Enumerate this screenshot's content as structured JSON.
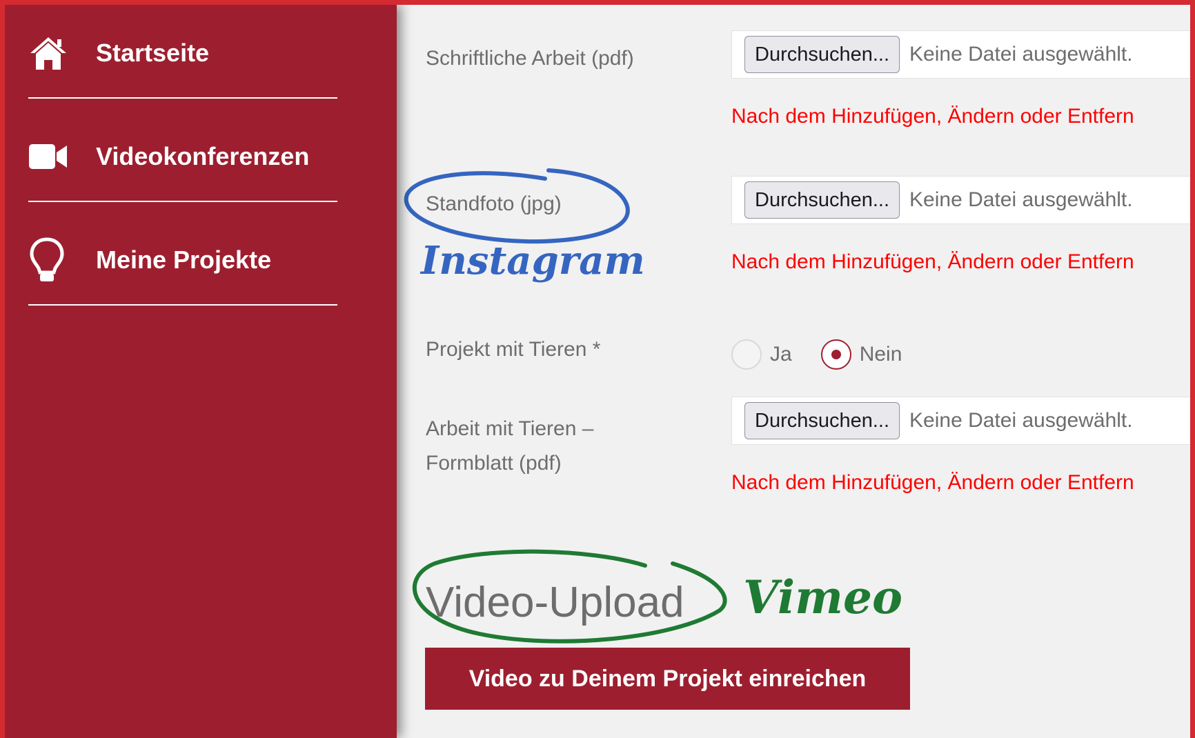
{
  "sidebar": {
    "items": [
      {
        "label": "Startseite",
        "icon": "home-icon"
      },
      {
        "label": "Videokonferenzen",
        "icon": "video-camera-icon"
      },
      {
        "label": "Meine Projekte",
        "icon": "lightbulb-icon"
      }
    ]
  },
  "form": {
    "browse_label": "Durchsuchen...",
    "no_file_label": "Keine Datei ausgewählt.",
    "warning_text": "Nach dem Hinzufügen, Ändern oder Entfern",
    "fields": [
      {
        "label": "Schriftliche Arbeit (pdf)"
      },
      {
        "label": "Standfoto (jpg)"
      },
      {
        "label_line1": "Arbeit mit Tieren –",
        "label_line2": "Formblatt (pdf)"
      }
    ],
    "animals": {
      "label": "Projekt mit Tieren *",
      "options": [
        "Ja",
        "Nein"
      ],
      "selected": "Nein"
    }
  },
  "video_section": {
    "title": "Video-Upload",
    "submit_label": "Video zu Deinem Projekt einreichen"
  },
  "annotations": {
    "instagram": "Instagram",
    "vimeo": "Vimeo"
  },
  "colors": {
    "brand": "#9d1f2f",
    "frame": "#d42a32",
    "warning": "#ff0000",
    "annotation_blue": "#3565c0",
    "annotation_green": "#1f7a33"
  }
}
